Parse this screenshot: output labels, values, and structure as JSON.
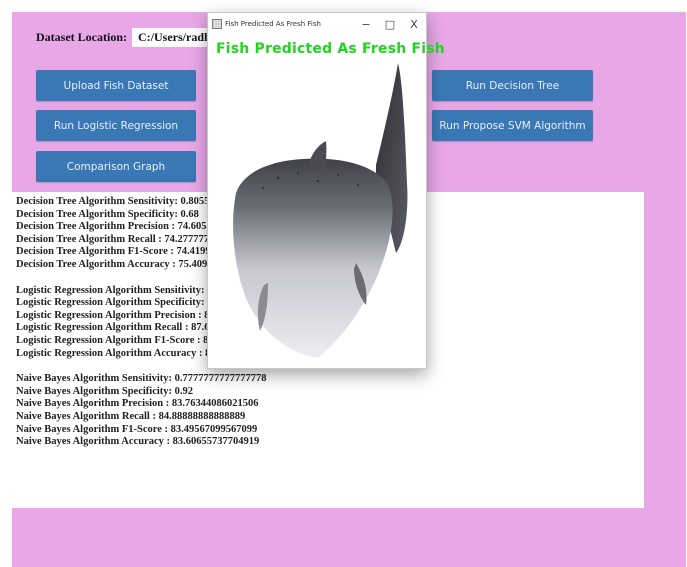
{
  "location": {
    "label": "Dataset Location:",
    "value": "C:/Users/radhi/One"
  },
  "buttons": {
    "upload": "Upload Fish Dataset",
    "logistic": "Run Logistic Regression",
    "comparison": "Comparison Graph",
    "decision_tree": "Run Decision Tree",
    "svm": "Run Propose SVM Algorithm"
  },
  "output_lines": [
    "Decision Tree Algorithm Sensitivity: 0.8055555555",
    "Decision Tree Algorithm Specificity: 0.68",
    "Decision Tree Algorithm Precision  : 74.6058558",
    "Decision Tree Algorithm Recall    : 74.27777777",
    "Decision Tree Algorithm F1-Score  : 74.4199049",
    "Decision Tree Algorithm Accuracy  : 75.4098360",
    "",
    "Logistic Regression Algorithm Sensitivity: 0.833",
    "Logistic Regression Algorithm Specificity: 0.92",
    "Logistic Regression Algorithm Precision  : 86.53",
    "Logistic Regression Algorithm Recall    : 87.666",
    "Logistic Regression Algorithm F1-Score  : 86.71023965141613",
    "Logistic Regression Algorithm Accuracy  : 86.88524590163934",
    "",
    "Naive Bayes Algorithm Sensitivity: 0.7777777777777778",
    "Naive Bayes Algorithm Specificity: 0.92",
    "Naive Bayes Algorithm Precision  : 83.76344086021506",
    "Naive Bayes Algorithm Recall    : 84.88888888888889",
    "Naive Bayes Algorithm F1-Score  : 83.49567099567099",
    "Naive Bayes Algorithm Accuracy  : 83.60655737704919"
  ],
  "popup": {
    "title": "Fish Predicted As Fresh Fish",
    "caption": "Fish Predicted As Fresh Fish",
    "minimize": "−",
    "maximize": "□",
    "close": "X",
    "caption_color": "#1fd51f"
  },
  "colors": {
    "background": "#e8a8e8",
    "button": "#3a78b5"
  }
}
